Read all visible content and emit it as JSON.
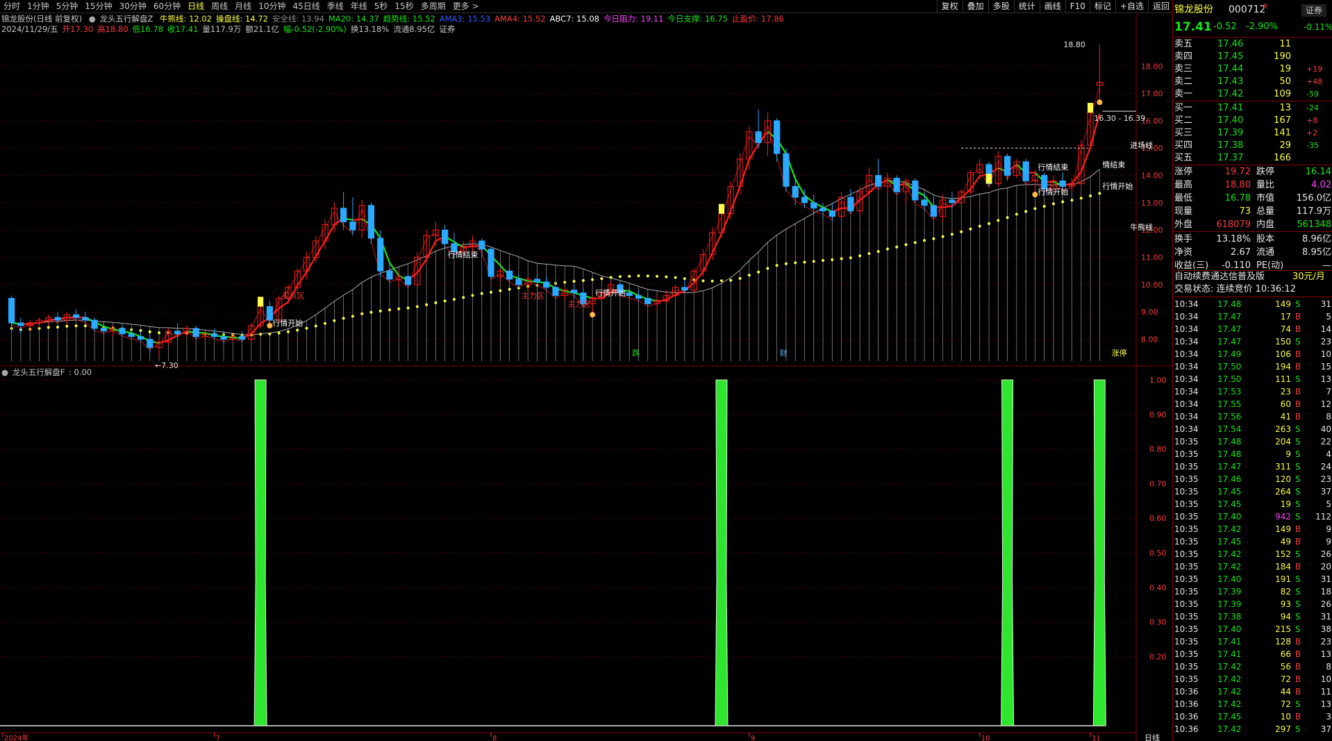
{
  "toolbar": {
    "periods": [
      "分时",
      "1分钟",
      "5分钟",
      "15分钟",
      "30分钟",
      "60分钟",
      "日线",
      "周线",
      "月线",
      "10分钟",
      "45日线",
      "季线",
      "年线",
      "5秒",
      "15秒",
      "多周期",
      "更多 >"
    ],
    "active_period": "日线",
    "right_buttons": [
      "复权",
      "叠加",
      "多股",
      "统计",
      "画线",
      "F10",
      "标记",
      "+自选",
      "返回"
    ]
  },
  "header": {
    "stock_title": "锦龙股份(日线 前复权)",
    "indicator_main": "龙头五行解盘Z",
    "ind_values": [
      {
        "label": "牛熊线: 12.02",
        "color": "#ffff4a"
      },
      {
        "label": "操盘线: 14.72",
        "color": "#ffff4a"
      },
      {
        "label": "安全线: 13.94",
        "color": "#8c8c8c"
      },
      {
        "label": "MA20: 14.37",
        "color": "#19e619"
      },
      {
        "label": "趋势线: 15.52",
        "color": "#19e619"
      },
      {
        "label": "AMA3: 15.53",
        "color": "#2a5cff"
      },
      {
        "label": "AMA4: 15.52",
        "color": "#ff3b3b"
      },
      {
        "label": "ABC7: 15.08",
        "color": "#ffffff"
      },
      {
        "label": "今日阻力: 19.11",
        "color": "#ff44ff"
      },
      {
        "label": "今日支撑: 16.75",
        "color": "#19e619"
      },
      {
        "label": "止盈价: 17.86",
        "color": "#ff3b3b"
      }
    ],
    "day_row": [
      {
        "label": "2024/11/29/五",
        "color": "#c8c8c8"
      },
      {
        "label": "开17.30",
        "color": "#ff3b3b"
      },
      {
        "label": "高18.80",
        "color": "#ff3b3b"
      },
      {
        "label": "低16.78",
        "color": "#19e619"
      },
      {
        "label": "收17.41",
        "color": "#19e619"
      },
      {
        "label": "量117.9万",
        "color": "#c8c8c8"
      },
      {
        "label": "额21.1亿",
        "color": "#c8c8c8"
      },
      {
        "label": "幅-0.52(-2.90%)",
        "color": "#19e619"
      },
      {
        "label": "换13.18%",
        "color": "#c8c8c8"
      },
      {
        "label": "流通8.95亿",
        "color": "#c8c8c8"
      },
      {
        "label": "证券",
        "color": "#c8c8c8"
      }
    ]
  },
  "chart_data": [
    {
      "type": "candlestick",
      "title": "锦龙股份(日线 前复权)",
      "y_ticks": [
        "18.00",
        "17.00",
        "16.00",
        "15.00",
        "14.00",
        "13.00",
        "12.00",
        "11.00",
        "10.00",
        "9.00",
        "8.00"
      ],
      "ylim": [
        7.2,
        19.1
      ],
      "high_label": "18.80",
      "low_label": "7.30",
      "range_label": "16.30 - 16.39",
      "ohlc": [
        [
          9.5,
          9.6,
          8.3,
          8.6
        ],
        [
          8.6,
          8.8,
          8.2,
          8.5
        ],
        [
          8.5,
          8.7,
          8.3,
          8.6
        ],
        [
          8.6,
          8.8,
          8.4,
          8.7
        ],
        [
          8.7,
          8.9,
          8.5,
          8.8
        ],
        [
          8.8,
          9.0,
          8.6,
          8.7
        ],
        [
          8.7,
          9.0,
          8.6,
          8.9
        ],
        [
          8.9,
          9.1,
          8.7,
          8.8
        ],
        [
          8.8,
          9.0,
          8.6,
          8.7
        ],
        [
          8.7,
          8.8,
          8.3,
          8.4
        ],
        [
          8.4,
          8.6,
          8.2,
          8.3
        ],
        [
          8.3,
          8.5,
          8.1,
          8.4
        ],
        [
          8.4,
          8.5,
          8.1,
          8.2
        ],
        [
          8.2,
          8.4,
          8.0,
          8.1
        ],
        [
          8.1,
          8.3,
          7.9,
          8.0
        ],
        [
          8.0,
          8.2,
          7.5,
          7.7
        ],
        [
          7.7,
          8.0,
          7.3,
          7.9
        ],
        [
          7.9,
          8.4,
          7.8,
          8.3
        ],
        [
          8.3,
          8.6,
          8.0,
          8.2
        ],
        [
          8.2,
          8.5,
          8.1,
          8.4
        ],
        [
          8.4,
          8.5,
          8.0,
          8.1
        ],
        [
          8.1,
          8.3,
          7.9,
          8.2
        ],
        [
          8.2,
          8.4,
          8.0,
          8.1
        ],
        [
          8.1,
          8.3,
          7.8,
          8.0
        ],
        [
          8.0,
          8.2,
          7.9,
          8.1
        ],
        [
          8.1,
          8.3,
          7.9,
          8.0
        ],
        [
          8.0,
          8.6,
          7.9,
          8.5
        ],
        [
          8.5,
          9.3,
          8.4,
          9.2
        ],
        [
          9.2,
          9.4,
          8.6,
          8.7
        ],
        [
          8.7,
          9.6,
          8.6,
          9.5
        ],
        [
          9.5,
          10.0,
          9.3,
          9.9
        ],
        [
          9.9,
          10.6,
          9.7,
          10.5
        ],
        [
          10.5,
          11.2,
          10.2,
          11.0
        ],
        [
          11.0,
          11.8,
          10.8,
          11.6
        ],
        [
          11.6,
          12.4,
          11.3,
          12.2
        ],
        [
          12.2,
          13.0,
          11.9,
          12.8
        ],
        [
          12.8,
          13.4,
          12.0,
          12.3
        ],
        [
          12.3,
          13.2,
          11.8,
          12.0
        ],
        [
          12.0,
          13.1,
          11.7,
          12.9
        ],
        [
          12.9,
          13.0,
          11.5,
          11.7
        ],
        [
          11.7,
          12.0,
          10.3,
          10.5
        ],
        [
          10.5,
          10.8,
          10.0,
          10.2
        ],
        [
          10.2,
          10.5,
          9.9,
          10.3
        ],
        [
          10.3,
          10.4,
          9.9,
          10.0
        ],
        [
          10.0,
          11.2,
          9.9,
          11.0
        ],
        [
          11.0,
          12.0,
          10.8,
          11.8
        ],
        [
          11.8,
          12.3,
          11.4,
          12.0
        ],
        [
          12.0,
          12.2,
          11.3,
          11.5
        ],
        [
          11.5,
          11.9,
          11.0,
          11.2
        ],
        [
          11.2,
          11.6,
          11.0,
          11.4
        ],
        [
          11.4,
          11.8,
          11.2,
          11.6
        ],
        [
          11.6,
          11.7,
          11.0,
          11.3
        ],
        [
          11.3,
          11.4,
          10.2,
          10.3
        ],
        [
          10.3,
          10.6,
          10.1,
          10.5
        ],
        [
          10.5,
          10.7,
          10.1,
          10.2
        ],
        [
          10.2,
          10.4,
          9.9,
          10.0
        ],
        [
          10.0,
          10.3,
          9.8,
          10.2
        ],
        [
          10.2,
          10.4,
          9.9,
          10.1
        ],
        [
          10.1,
          10.3,
          9.8,
          9.9
        ],
        [
          9.9,
          10.1,
          9.5,
          9.6
        ],
        [
          9.6,
          9.9,
          9.4,
          9.8
        ],
        [
          9.8,
          10.0,
          9.5,
          9.7
        ],
        [
          9.7,
          9.9,
          9.2,
          9.3
        ],
        [
          9.3,
          9.6,
          9.0,
          9.5
        ],
        [
          9.5,
          9.8,
          9.4,
          9.7
        ],
        [
          9.7,
          10.1,
          9.6,
          10.0
        ],
        [
          10.0,
          10.1,
          9.6,
          9.7
        ],
        [
          9.7,
          9.9,
          9.5,
          9.6
        ],
        [
          9.6,
          9.8,
          9.4,
          9.5
        ],
        [
          9.5,
          9.7,
          9.2,
          9.3
        ],
        [
          9.3,
          9.6,
          9.1,
          9.4
        ],
        [
          9.4,
          9.8,
          9.3,
          9.6
        ],
        [
          9.6,
          10.0,
          9.5,
          9.9
        ],
        [
          9.9,
          10.2,
          9.7,
          9.8
        ],
        [
          9.8,
          10.6,
          9.7,
          10.5
        ],
        [
          10.5,
          11.3,
          10.3,
          11.1
        ],
        [
          11.1,
          12.1,
          10.9,
          11.9
        ],
        [
          11.9,
          12.8,
          11.7,
          12.6
        ],
        [
          12.6,
          13.8,
          12.4,
          13.6
        ],
        [
          13.6,
          14.8,
          13.3,
          14.6
        ],
        [
          14.6,
          15.8,
          14.2,
          15.6
        ],
        [
          15.6,
          16.4,
          15.0,
          15.2
        ],
        [
          15.2,
          16.3,
          14.7,
          16.0
        ],
        [
          16.0,
          16.1,
          14.5,
          14.8
        ],
        [
          14.8,
          15.0,
          13.4,
          13.6
        ],
        [
          13.6,
          14.0,
          12.9,
          13.2
        ],
        [
          13.2,
          13.5,
          12.8,
          13.0
        ],
        [
          13.0,
          13.3,
          12.6,
          12.8
        ],
        [
          12.8,
          13.0,
          12.4,
          12.7
        ],
        [
          12.7,
          13.0,
          12.3,
          12.5
        ],
        [
          12.5,
          13.4,
          12.4,
          13.2
        ],
        [
          13.2,
          13.5,
          12.6,
          12.7
        ],
        [
          12.7,
          13.6,
          12.5,
          13.4
        ],
        [
          13.4,
          14.3,
          13.2,
          14.0
        ],
        [
          14.0,
          14.6,
          13.5,
          13.6
        ],
        [
          13.6,
          14.1,
          13.3,
          13.9
        ],
        [
          13.9,
          14.0,
          13.3,
          13.4
        ],
        [
          13.4,
          13.9,
          13.0,
          13.8
        ],
        [
          13.8,
          13.9,
          13.0,
          13.1
        ],
        [
          13.1,
          13.4,
          12.7,
          12.9
        ],
        [
          12.9,
          13.2,
          12.4,
          12.5
        ],
        [
          12.5,
          13.3,
          12.3,
          13.1
        ],
        [
          13.1,
          13.4,
          12.8,
          13.0
        ],
        [
          13.0,
          13.5,
          12.9,
          13.4
        ],
        [
          13.4,
          14.2,
          13.3,
          14.1
        ],
        [
          14.1,
          14.6,
          13.9,
          14.4
        ],
        [
          14.4,
          14.5,
          13.6,
          13.7
        ],
        [
          13.7,
          14.9,
          13.6,
          14.7
        ],
        [
          14.7,
          14.8,
          13.8,
          14.0
        ],
        [
          14.0,
          14.6,
          13.9,
          14.5
        ],
        [
          14.5,
          14.6,
          13.7,
          13.8
        ],
        [
          13.8,
          14.2,
          13.4,
          14.0
        ],
        [
          14.0,
          14.1,
          13.3,
          13.5
        ],
        [
          13.5,
          14.0,
          13.4,
          13.8
        ],
        [
          13.8,
          14.1,
          13.5,
          13.6
        ],
        [
          13.6,
          13.9,
          13.4,
          13.7
        ],
        [
          13.7,
          15.3,
          13.6,
          15.1
        ],
        [
          15.1,
          16.4,
          14.9,
          16.3
        ],
        [
          17.3,
          18.8,
          16.78,
          17.41
        ]
      ]
    },
    {
      "type": "bar",
      "title": "龙头五行解盘F",
      "value_label": "0.00",
      "y_ticks": [
        "1.00",
        "0.90",
        "0.80",
        "0.70",
        "0.60",
        "0.50",
        "0.40",
        "0.30",
        "0.20"
      ],
      "ylim": [
        0,
        1.0
      ],
      "signal_bars_at_index": [
        27,
        77,
        108,
        118
      ]
    }
  ],
  "annotations": [
    {
      "text": "行情开始",
      "color": "#ffffff"
    },
    {
      "text": "买点区",
      "color": "#ff3b3b"
    },
    {
      "text": "行情结束",
      "color": "#ffffff"
    },
    {
      "text": "主力区",
      "color": "#ff3b3b"
    },
    {
      "text": "行情开始",
      "color": "#ffffff"
    },
    {
      "text": "主力区",
      "color": "#ff3b3b"
    },
    {
      "text": "行情结束",
      "color": "#ffffff"
    },
    {
      "text": "行情开始",
      "color": "#ffffff"
    },
    {
      "text": "情结束",
      "color": "#ffffff"
    },
    {
      "text": "行情开始",
      "color": "#ffffff"
    },
    {
      "text": "进场线",
      "color": "#ffffff"
    },
    {
      "text": "牛熊线",
      "color": "#ffffff"
    },
    {
      "text": "跌",
      "color": "#19e619"
    },
    {
      "text": "财",
      "color": "#5ab4ff"
    },
    {
      "text": "涨停",
      "color": "#ffff4a"
    }
  ],
  "x_axis": {
    "labels": [
      "2024年",
      "7",
      "8",
      "9",
      "10",
      "11"
    ],
    "right_label": "日线"
  },
  "right_panel": {
    "stock_name": "锦龙股份",
    "stock_code": "000712",
    "badge": "R",
    "tag": "证券",
    "price": "17.41",
    "change": "-0.52",
    "change_pct": "-2.90%",
    "right_pct": "-0.11%",
    "asks": [
      {
        "label": "卖五",
        "price": "17.46",
        "vol": "11",
        "diff": ""
      },
      {
        "label": "卖四",
        "price": "17.45",
        "vol": "190",
        "diff": ""
      },
      {
        "label": "卖三",
        "price": "17.44",
        "vol": "19",
        "diff": "+19"
      },
      {
        "label": "卖二",
        "price": "17.43",
        "vol": "50",
        "diff": "+48"
      },
      {
        "label": "卖一",
        "price": "17.42",
        "vol": "109",
        "diff": "-59"
      }
    ],
    "bids": [
      {
        "label": "买一",
        "price": "17.41",
        "vol": "13",
        "diff": "-24"
      },
      {
        "label": "买二",
        "price": "17.40",
        "vol": "167",
        "diff": "+8"
      },
      {
        "label": "买三",
        "price": "17.39",
        "vol": "141",
        "diff": "+2"
      },
      {
        "label": "买四",
        "price": "17.38",
        "vol": "29",
        "diff": "-35"
      },
      {
        "label": "买五",
        "price": "17.37",
        "vol": "166",
        "diff": ""
      }
    ],
    "stats": [
      {
        "l1": "涨停",
        "v1": "19.72",
        "c1": "#ff3b3b",
        "l2": "跌停",
        "v2": "16.14",
        "c2": "#19e619"
      },
      {
        "l1": "最高",
        "v1": "18.80",
        "c1": "#ff3b3b",
        "l2": "量比",
        "v2": "4.02",
        "c2": "#ff44ff"
      },
      {
        "l1": "最低",
        "v1": "16.78",
        "c1": "#19e619",
        "l2": "市值",
        "v2": "156.0亿",
        "c2": "#e8e8e8"
      },
      {
        "l1": "现量",
        "v1": "73",
        "c1": "#ffff4a",
        "l2": "总量",
        "v2": "117.9万",
        "c2": "#e8e8e8"
      },
      {
        "l1": "外盘",
        "v1": "618079",
        "c1": "#ff3b3b",
        "l2": "内盘",
        "v2": "561348",
        "c2": "#19e619"
      }
    ],
    "stats2": [
      {
        "l1": "换手",
        "v1": "13.18%",
        "c1": "#e8e8e8",
        "l2": "股本",
        "v2": "8.96亿",
        "c2": "#e8e8e8"
      },
      {
        "l1": "净资",
        "v1": "2.67",
        "c1": "#e8e8e8",
        "l2": "流通",
        "v2": "8.95亿",
        "c2": "#e8e8e8"
      },
      {
        "l1": "收益(三)",
        "v1": "-0.110",
        "c1": "#e8e8e8",
        "l2": "PE(动)",
        "v2": "—",
        "c2": "#e8e8e8"
      }
    ],
    "promo": "自动续费通达信普及版",
    "promo_price": "30元/月",
    "trade_status": "交易状态: 连续竞价 10:36:12",
    "ticks": [
      [
        "10:34",
        "17.48",
        "149",
        "S",
        "31"
      ],
      [
        "10:34",
        "17.47",
        "17",
        "B",
        "5"
      ],
      [
        "10:34",
        "17.47",
        "74",
        "B",
        "14"
      ],
      [
        "10:34",
        "17.47",
        "150",
        "S",
        "23"
      ],
      [
        "10:34",
        "17.49",
        "106",
        "B",
        "10"
      ],
      [
        "10:34",
        "17.50",
        "194",
        "B",
        "15"
      ],
      [
        "10:34",
        "17.50",
        "111",
        "S",
        "13"
      ],
      [
        "10:34",
        "17.53",
        "23",
        "B",
        "7"
      ],
      [
        "10:34",
        "17.55",
        "60",
        "B",
        "12"
      ],
      [
        "10:34",
        "17.56",
        "41",
        "B",
        "8"
      ],
      [
        "10:34",
        "17.54",
        "263",
        "S",
        "40"
      ],
      [
        "10:35",
        "17.48",
        "204",
        "S",
        "22"
      ],
      [
        "10:35",
        "17.48",
        "9",
        "S",
        "4"
      ],
      [
        "10:35",
        "17.47",
        "311",
        "S",
        "24"
      ],
      [
        "10:35",
        "17.46",
        "120",
        "S",
        "23"
      ],
      [
        "10:35",
        "17.45",
        "264",
        "S",
        "37"
      ],
      [
        "10:35",
        "17.45",
        "19",
        "S",
        "5"
      ],
      [
        "10:35",
        "17.40",
        "942",
        "S",
        "112"
      ],
      [
        "10:35",
        "17.42",
        "149",
        "B",
        "9"
      ],
      [
        "10:35",
        "17.45",
        "49",
        "B",
        "9"
      ],
      [
        "10:35",
        "17.42",
        "152",
        "S",
        "26"
      ],
      [
        "10:35",
        "17.42",
        "184",
        "B",
        "20"
      ],
      [
        "10:35",
        "17.40",
        "191",
        "S",
        "31"
      ],
      [
        "10:35",
        "17.39",
        "82",
        "S",
        "18"
      ],
      [
        "10:35",
        "17.39",
        "93",
        "S",
        "26"
      ],
      [
        "10:35",
        "17.38",
        "94",
        "S",
        "31"
      ],
      [
        "10:35",
        "17.40",
        "215",
        "S",
        "38"
      ],
      [
        "10:35",
        "17.41",
        "128",
        "B",
        "23"
      ],
      [
        "10:35",
        "17.41",
        "66",
        "B",
        "13"
      ],
      [
        "10:35",
        "17.42",
        "56",
        "B",
        "8"
      ],
      [
        "10:35",
        "17.42",
        "72",
        "B",
        "10"
      ],
      [
        "10:36",
        "17.42",
        "44",
        "B",
        "11"
      ],
      [
        "10:36",
        "17.42",
        "72",
        "S",
        "13"
      ],
      [
        "10:36",
        "17.45",
        "10",
        "B",
        "3"
      ],
      [
        "10:36",
        "17.42",
        "297",
        "S",
        "37"
      ]
    ]
  }
}
